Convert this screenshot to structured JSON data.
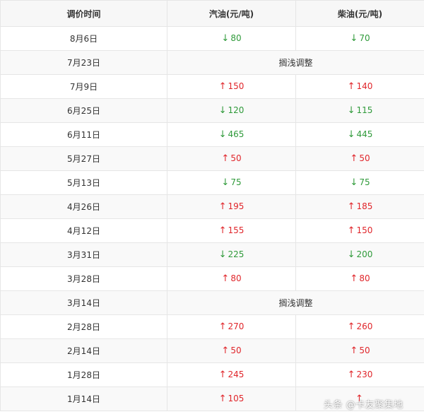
{
  "table": {
    "headers": [
      "调价时间",
      "汽油(元/吨)",
      "柴油(元/吨)"
    ],
    "rows": [
      {
        "date": "8月6日",
        "gas": {
          "dir": "down",
          "value": "80"
        },
        "diesel": {
          "dir": "down",
          "value": "70"
        }
      },
      {
        "date": "7月23日",
        "merged": "搁浅调整"
      },
      {
        "date": "7月9日",
        "gas": {
          "dir": "up",
          "value": "150"
        },
        "diesel": {
          "dir": "up",
          "value": "140"
        }
      },
      {
        "date": "6月25日",
        "gas": {
          "dir": "down",
          "value": "120"
        },
        "diesel": {
          "dir": "down",
          "value": "115"
        }
      },
      {
        "date": "6月11日",
        "gas": {
          "dir": "down",
          "value": "465"
        },
        "diesel": {
          "dir": "down",
          "value": "445"
        }
      },
      {
        "date": "5月27日",
        "gas": {
          "dir": "up",
          "value": "50"
        },
        "diesel": {
          "dir": "up",
          "value": "50"
        }
      },
      {
        "date": "5月13日",
        "gas": {
          "dir": "down",
          "value": "75"
        },
        "diesel": {
          "dir": "down",
          "value": "75"
        }
      },
      {
        "date": "4月26日",
        "gas": {
          "dir": "up",
          "value": "195"
        },
        "diesel": {
          "dir": "up",
          "value": "185"
        }
      },
      {
        "date": "4月12日",
        "gas": {
          "dir": "up",
          "value": "155"
        },
        "diesel": {
          "dir": "up",
          "value": "150"
        }
      },
      {
        "date": "3月31日",
        "gas": {
          "dir": "down",
          "value": "225"
        },
        "diesel": {
          "dir": "down",
          "value": "200"
        }
      },
      {
        "date": "3月28日",
        "gas": {
          "dir": "up",
          "value": "80"
        },
        "diesel": {
          "dir": "up",
          "value": "80"
        }
      },
      {
        "date": "3月14日",
        "merged": "搁浅调整"
      },
      {
        "date": "2月28日",
        "gas": {
          "dir": "up",
          "value": "270"
        },
        "diesel": {
          "dir": "up",
          "value": "260"
        }
      },
      {
        "date": "2月14日",
        "gas": {
          "dir": "up",
          "value": "50"
        },
        "diesel": {
          "dir": "up",
          "value": "50"
        }
      },
      {
        "date": "1月28日",
        "gas": {
          "dir": "up",
          "value": "245"
        },
        "diesel": {
          "dir": "up",
          "value": "230"
        }
      },
      {
        "date": "1月14日",
        "gas": {
          "dir": "up",
          "value": "105"
        },
        "diesel": {
          "dir": "up",
          "value": ""
        }
      }
    ]
  },
  "arrows": {
    "up": "↑",
    "down": "↓"
  },
  "colors": {
    "up": "#e0262b",
    "down": "#2f9a3a"
  },
  "watermark": "头条 @卡友聚集地"
}
